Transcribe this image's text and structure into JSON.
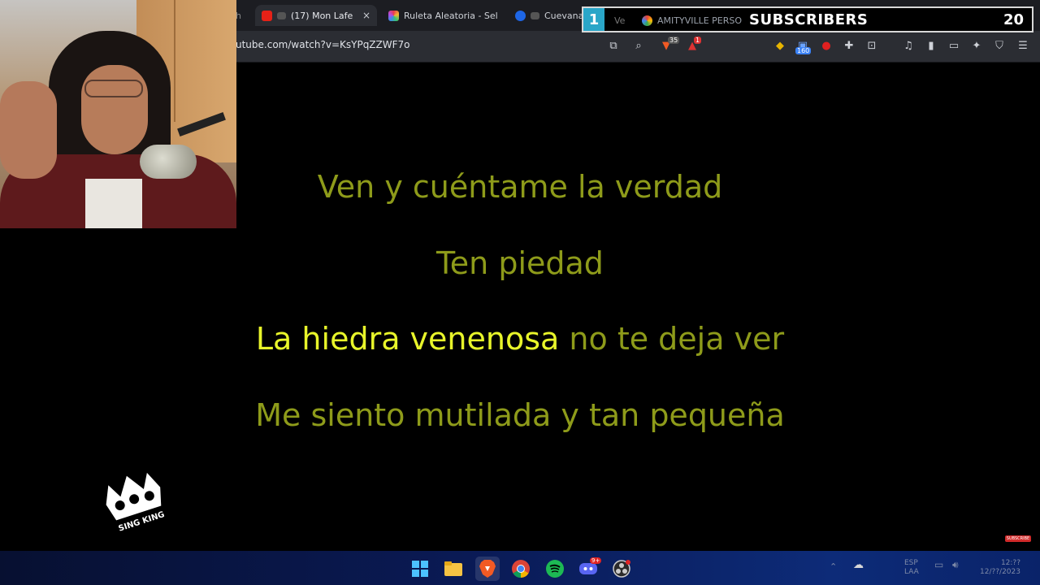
{
  "browser": {
    "tabs": [
      {
        "label": "(17) Mon Lafe",
        "favicon": "youtube-icon",
        "active": true
      },
      {
        "label": "Ruleta Aleatoria - Sele",
        "favicon": "ruleta-icon",
        "active": false
      },
      {
        "label": "Cuevana",
        "favicon": "cuevana-icon",
        "active": false
      },
      {
        "label": "AMITYVILLE PERSON",
        "favicon": "google-icon",
        "active": false
      }
    ],
    "left_tab_fragment": "h",
    "ve_fragment": "Ve",
    "close_glyph": "×",
    "new_tab_glyph": "+",
    "url": "utube.com/watch?v=KsYPqZZWF7o",
    "extension_badges": {
      "brave_count": "35",
      "alert_count": "1",
      "ext_count": "160"
    }
  },
  "subscribers": {
    "number": "1",
    "label": "SUBSCRIBERS",
    "count": "20"
  },
  "lyrics": {
    "line1": "Ven y cuéntame la verdad",
    "line2": "Ten piedad",
    "line3_highlight": "La hiedra venenosa",
    "line3_rest": "no te deja ver",
    "line4": "Me siento mutilada y tan pequeña"
  },
  "logo_text": "SING KING",
  "subscribe_mini": "SUBSCRIBE",
  "taskbar": {
    "apps": [
      "windows-start-icon",
      "file-explorer-icon",
      "brave-icon",
      "chrome-icon",
      "spotify-icon",
      "discord-icon",
      "obs-icon"
    ],
    "discord_badge": "9+",
    "lang_top": "ESP",
    "lang_bottom": "LAA",
    "time": "12:??",
    "date": "12/??/2023"
  },
  "colors": {
    "lyric_dim": "#8e9b1a",
    "lyric_highlight": "#e8f52a",
    "sub_accent": "#2aa6c8"
  }
}
